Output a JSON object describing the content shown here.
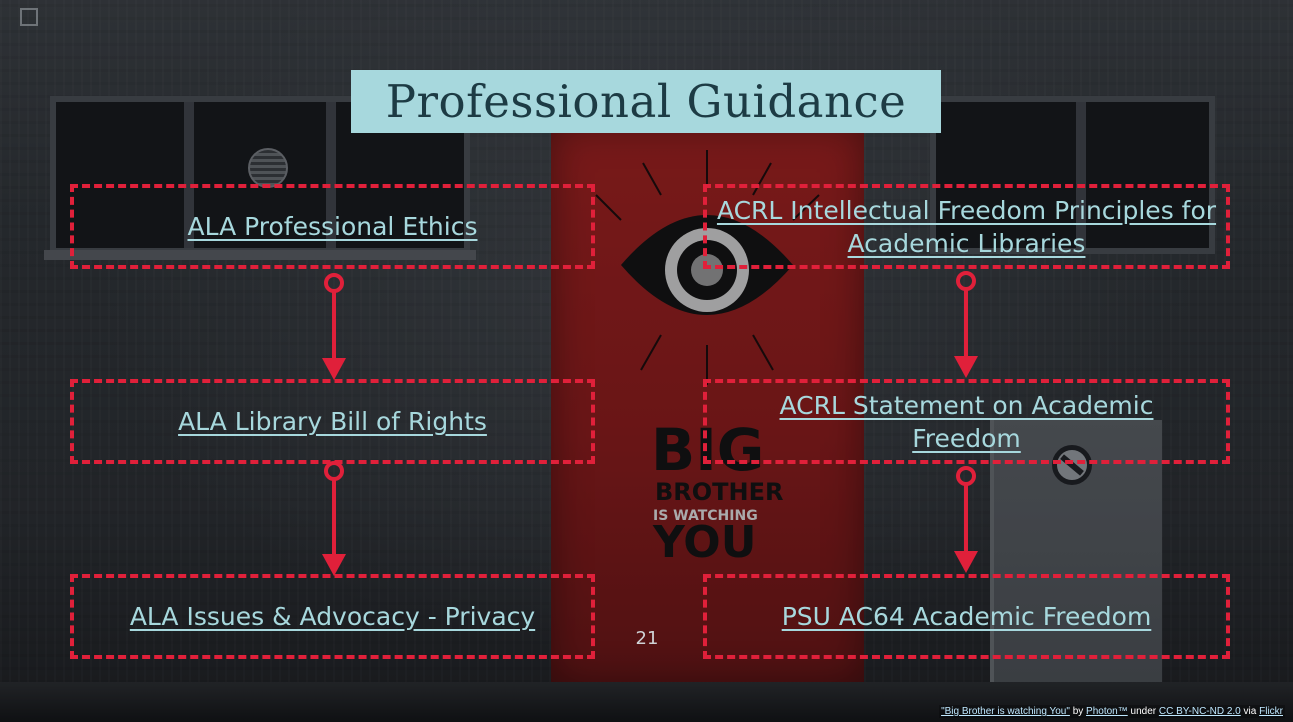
{
  "slide": {
    "title": "Professional Guidance",
    "page_number": "21"
  },
  "boxes": {
    "ala_ethics": "ALA Professional Ethics",
    "ala_bill_of_rights": "ALA Library Bill of Rights",
    "ala_privacy": "ALA Issues & Advocacy - Privacy",
    "acrl_intellectual_freedom": "ACRL Intellectual Freedom Principles for Academic Libraries",
    "acrl_statement": "ACRL Statement on Academic Freedom",
    "psu_ac64": "PSU AC64 Academic Freedom"
  },
  "attribution": {
    "work": "\"Big Brother is watching You\"",
    "by": "by",
    "author": "Photon™",
    "under": "under",
    "license": "CC BY-NC-ND 2.0",
    "via": "via",
    "source": "Flickr"
  },
  "colors": {
    "accent_red": "#e0203a",
    "link_teal": "#a7d8dd",
    "title_bg": "#a7d8dd"
  }
}
